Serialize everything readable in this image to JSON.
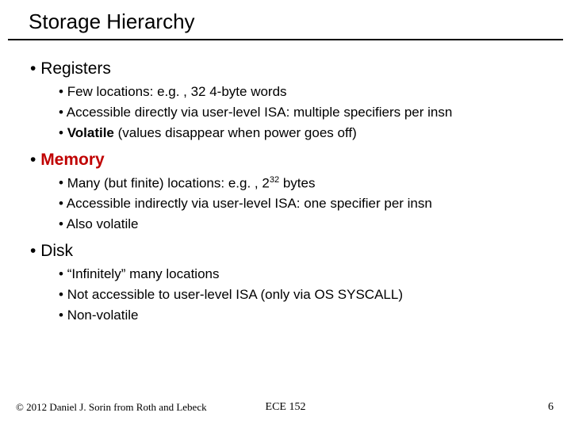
{
  "title": "Storage Hierarchy",
  "sections": [
    {
      "heading": "Registers",
      "heading_bold": false,
      "heading_red": false,
      "items": [
        {
          "parts": [
            {
              "t": "Few locations: e.g. , 32 4-byte words"
            }
          ]
        },
        {
          "parts": [
            {
              "t": "Accessible directly via user-level ISA: multiple specifiers per insn"
            }
          ]
        },
        {
          "parts": [
            {
              "t": "Volatile",
              "bold": true
            },
            {
              "t": " (values disappear when power goes off)"
            }
          ]
        }
      ]
    },
    {
      "heading": "Memory",
      "heading_bold": true,
      "heading_red": true,
      "items": [
        {
          "parts": [
            {
              "t": "Many (but finite) locations: e.g. , 2"
            },
            {
              "t": "32",
              "sup": true
            },
            {
              "t": " bytes"
            }
          ]
        },
        {
          "parts": [
            {
              "t": "Accessible indirectly via user-level ISA: one specifier per insn"
            }
          ]
        },
        {
          "parts": [
            {
              "t": "Also volatile"
            }
          ]
        }
      ]
    },
    {
      "heading": "Disk",
      "heading_bold": false,
      "heading_red": false,
      "items": [
        {
          "parts": [
            {
              "t": "“Infinitely” many locations"
            }
          ]
        },
        {
          "parts": [
            {
              "t": "Not accessible to user-level ISA (only via OS SYSCALL)"
            }
          ]
        },
        {
          "parts": [
            {
              "t": "Non-volatile"
            }
          ]
        }
      ]
    }
  ],
  "footer": {
    "left": "© 2012 Daniel J. Sorin from Roth and Lebeck",
    "center": "ECE 152",
    "right": "6"
  }
}
